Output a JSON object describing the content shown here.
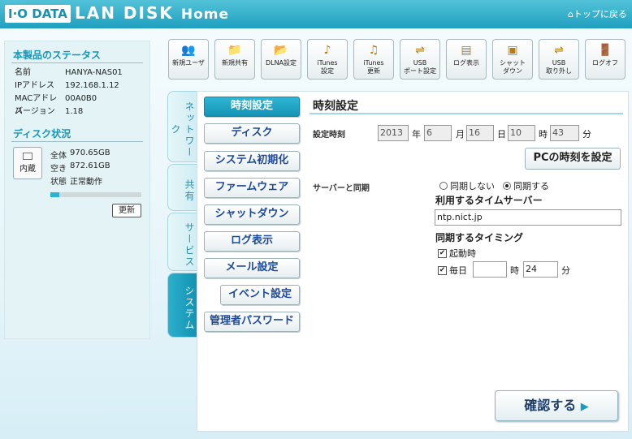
{
  "header": {
    "logo": "I·O DATA",
    "brand": "LAN DISK",
    "brand_home": "Home",
    "top_link": "トップに戻る"
  },
  "status": {
    "title": "本製品のステータス",
    "rows": [
      {
        "k": "名前",
        "v": "HANYA-NAS01"
      },
      {
        "k": "IPアドレス",
        "v": "192.168.1.12"
      },
      {
        "k": "MACアドレス",
        "v": "00A0B0"
      },
      {
        "k": "バージョン",
        "v": "1.18"
      }
    ],
    "disk_title": "ディスク状況",
    "disk_icon_label": "内蔵",
    "disk_rows": [
      {
        "k": "全体",
        "v": "970.65GB"
      },
      {
        "k": "空き",
        "v": "872.61GB"
      },
      {
        "k": "状態",
        "v": "正常動作"
      }
    ],
    "usage_fraction": 0.1,
    "update_label": "更新"
  },
  "toolbar": [
    {
      "icon": "users-icon",
      "glyph": "👥",
      "l1": "新規ユーザ",
      "l2": ""
    },
    {
      "icon": "folder-icon",
      "glyph": "📁",
      "l1": "新規共有",
      "l2": ""
    },
    {
      "icon": "dlna-icon",
      "glyph": "📂",
      "l1": "DLNA設定",
      "l2": ""
    },
    {
      "icon": "itunes-icon",
      "glyph": "♪",
      "l1": "iTunes",
      "l2": "設定"
    },
    {
      "icon": "itunes-update-icon",
      "glyph": "♫",
      "l1": "iTunes",
      "l2": "更新"
    },
    {
      "icon": "usb-icon",
      "glyph": "⇌",
      "l1": "USB",
      "l2": "ポート設定"
    },
    {
      "icon": "log-icon",
      "glyph": "▤",
      "l1": "ログ表示",
      "l2": ""
    },
    {
      "icon": "shutdown-icon",
      "glyph": "▣",
      "l1": "シャット",
      "l2": "ダウン"
    },
    {
      "icon": "usb-eject-icon",
      "glyph": "⇌",
      "l1": "USB",
      "l2": "取り外し"
    },
    {
      "icon": "logoff-icon",
      "glyph": "🚪",
      "l1": "ログオフ",
      "l2": ""
    }
  ],
  "tabs": [
    "ネットワーク",
    "共有",
    "サービス",
    "システム"
  ],
  "menu": [
    "時刻設定",
    "ディスク",
    "システム初期化",
    "ファームウェア",
    "シャットダウン",
    "ログ表示",
    "メール設定",
    "イベント設定",
    "管理者パスワード"
  ],
  "page": {
    "title": "時刻設定",
    "time_label": "設定時刻",
    "year": "2013",
    "year_unit": "年",
    "month": "6",
    "month_unit": "月",
    "day": "16",
    "day_unit": "日",
    "hour": "10",
    "hour_unit": "時",
    "minute": "43",
    "minute_unit": "分",
    "pc_time_button": "PCの時刻を設定",
    "sync_label": "サーバーと同期",
    "sync_off": "同期しない",
    "sync_on": "同期する",
    "server_label": "利用するタイムサーバー",
    "server_value": "ntp.nict.jp",
    "timing_label": "同期するタイミング",
    "startup_label": "起動時",
    "daily_label": "毎日",
    "daily_hour": "",
    "daily_hour_unit": "時",
    "daily_minute": "24",
    "daily_minute_unit": "分",
    "confirm_button": "確認する",
    "confirm_arrow": "▶"
  }
}
